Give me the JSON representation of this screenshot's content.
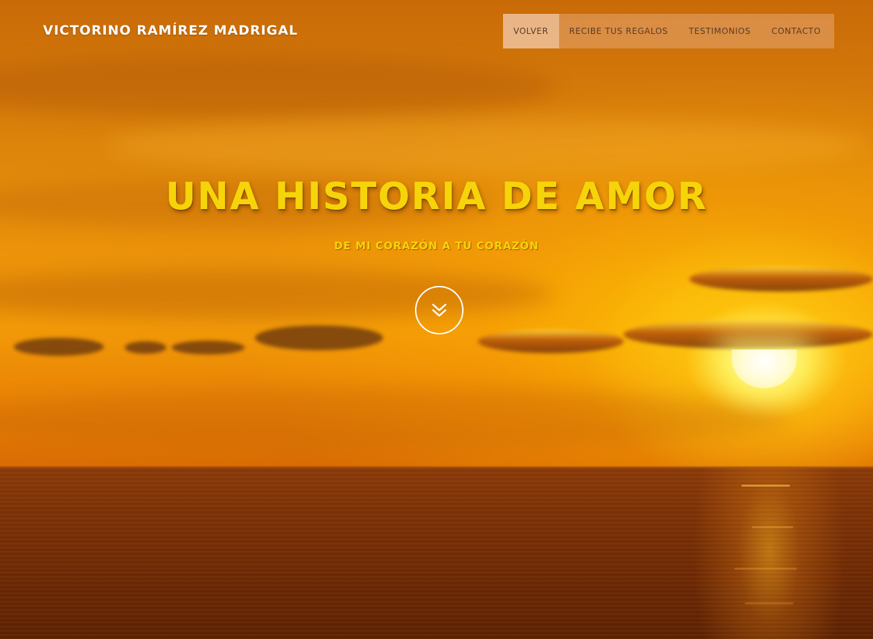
{
  "header": {
    "brand": "VICTORINO RAMÍREZ MADRIGAL",
    "nav": [
      {
        "label": "VOLVER",
        "active": true
      },
      {
        "label": "RECIBE TUS REGALOS",
        "active": false
      },
      {
        "label": "TESTIMONIOS",
        "active": false
      },
      {
        "label": "CONTACTO",
        "active": false
      }
    ]
  },
  "hero": {
    "title": "UNA HISTORIA DE AMOR",
    "subtitle": "DE MI CORAZÓN A TU CORAZÓN",
    "scroll_icon": "double-chevron-down-icon",
    "background": "sunset-over-sea"
  },
  "colors": {
    "title": "#f6d40a",
    "brand_text": "#ffffff",
    "nav_text": "#5a3a2a",
    "nav_bg": "rgba(235,180,140,0.45)"
  }
}
